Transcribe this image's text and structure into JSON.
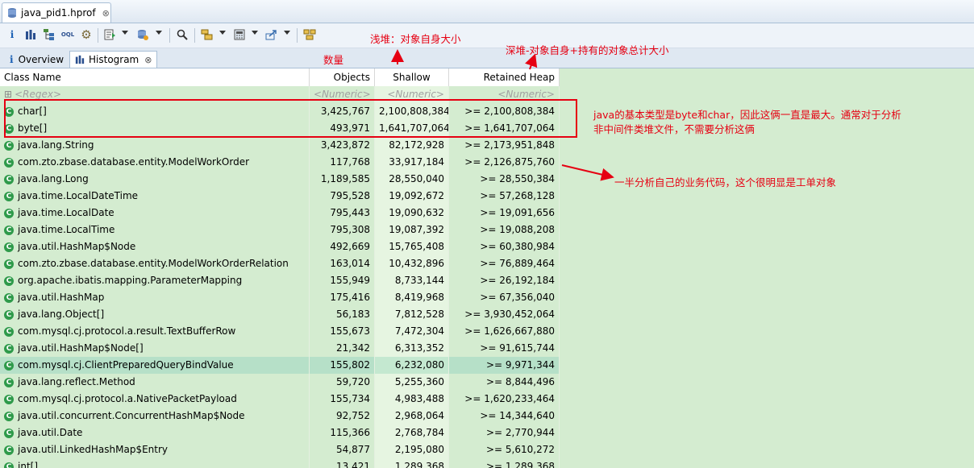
{
  "editor_tab": {
    "label": "java_pid1.hprof",
    "close": "⊗"
  },
  "toolbar": {
    "icons": [
      "info-icon",
      "histogram-icon",
      "dominator-tree-icon",
      "oql-icon",
      "thread-icon",
      "run-report-icon",
      "query-browser-icon",
      "search-icon",
      "group-icon",
      "calculate-icon",
      "export-icon",
      "compare-icon"
    ]
  },
  "view_tabs": {
    "overview": "Overview",
    "histogram": "Histogram",
    "histogram_close": "⊗"
  },
  "columns": {
    "name": "Class Name",
    "objects": "Objects",
    "shallow": "Shallow Heap",
    "retained": "Retained Heap"
  },
  "filter_row": {
    "name": "<Regex>",
    "objects": "<Numeric>",
    "shallow": "<Numeric>",
    "retained": "<Numeric>"
  },
  "rows": [
    {
      "name": "char[]",
      "objects": "3,425,767",
      "shallow": "2,100,808,384",
      "retained": ">= 2,100,808,384"
    },
    {
      "name": "byte[]",
      "objects": "493,971",
      "shallow": "1,641,707,064",
      "retained": ">= 1,641,707,064"
    },
    {
      "name": "java.lang.String",
      "objects": "3,423,872",
      "shallow": "82,172,928",
      "retained": ">= 2,173,951,848"
    },
    {
      "name": "com.zto.zbase.database.entity.ModelWorkOrder",
      "objects": "117,768",
      "shallow": "33,917,184",
      "retained": ">= 2,126,875,760"
    },
    {
      "name": "java.lang.Long",
      "objects": "1,189,585",
      "shallow": "28,550,040",
      "retained": ">= 28,550,384"
    },
    {
      "name": "java.time.LocalDateTime",
      "objects": "795,528",
      "shallow": "19,092,672",
      "retained": ">= 57,268,128"
    },
    {
      "name": "java.time.LocalDate",
      "objects": "795,443",
      "shallow": "19,090,632",
      "retained": ">= 19,091,656"
    },
    {
      "name": "java.time.LocalTime",
      "objects": "795,308",
      "shallow": "19,087,392",
      "retained": ">= 19,088,208"
    },
    {
      "name": "java.util.HashMap$Node",
      "objects": "492,669",
      "shallow": "15,765,408",
      "retained": ">= 60,380,984"
    },
    {
      "name": "com.zto.zbase.database.entity.ModelWorkOrderRelation",
      "objects": "163,014",
      "shallow": "10,432,896",
      "retained": ">= 76,889,464"
    },
    {
      "name": "org.apache.ibatis.mapping.ParameterMapping",
      "objects": "155,949",
      "shallow": "8,733,144",
      "retained": ">= 26,192,184"
    },
    {
      "name": "java.util.HashMap",
      "objects": "175,416",
      "shallow": "8,419,968",
      "retained": ">= 67,356,040"
    },
    {
      "name": "java.lang.Object[]",
      "objects": "56,183",
      "shallow": "7,812,528",
      "retained": ">= 3,930,452,064"
    },
    {
      "name": "com.mysql.cj.protocol.a.result.TextBufferRow",
      "objects": "155,673",
      "shallow": "7,472,304",
      "retained": ">= 1,626,667,880"
    },
    {
      "name": "java.util.HashMap$Node[]",
      "objects": "21,342",
      "shallow": "6,313,352",
      "retained": ">= 91,615,744"
    },
    {
      "name": "com.mysql.cj.ClientPreparedQueryBindValue",
      "objects": "155,802",
      "shallow": "6,232,080",
      "retained": ">= 9,971,344"
    },
    {
      "name": "java.lang.reflect.Method",
      "objects": "59,720",
      "shallow": "5,255,360",
      "retained": ">= 8,844,496"
    },
    {
      "name": "com.mysql.cj.protocol.a.NativePacketPayload",
      "objects": "155,734",
      "shallow": "4,983,488",
      "retained": ">= 1,620,233,464"
    },
    {
      "name": "java.util.concurrent.ConcurrentHashMap$Node",
      "objects": "92,752",
      "shallow": "2,968,064",
      "retained": ">= 14,344,640"
    },
    {
      "name": "java.util.Date",
      "objects": "115,366",
      "shallow": "2,768,784",
      "retained": ">= 2,770,944"
    },
    {
      "name": "java.util.LinkedHashMap$Entry",
      "objects": "54,877",
      "shallow": "2,195,080",
      "retained": ">= 5,610,272"
    },
    {
      "name": "int[]",
      "objects": "13,421",
      "shallow": "1,289,368",
      "retained": ">= 1,289,368"
    }
  ],
  "annotations": {
    "shallow": "浅堆：对象自身大小",
    "count": "数量",
    "retained": "深堆-对象自身+持有的对象总计大小",
    "primitive_line1": "java的基本类型是byte和char，因此这俩一直是最大。通常对于分析",
    "primitive_line2": "非中间件类堆文件，不需要分析这俩",
    "business": "一半分析自己的业务代码，这个很明显是工单对象"
  },
  "colors": {
    "annotation": "#e60012",
    "row_bg": "#d4ecd0",
    "shallow_bg": "#e6f5e1",
    "selected_bg": "#b6e0c8",
    "class_icon": "#2e9a4a"
  }
}
